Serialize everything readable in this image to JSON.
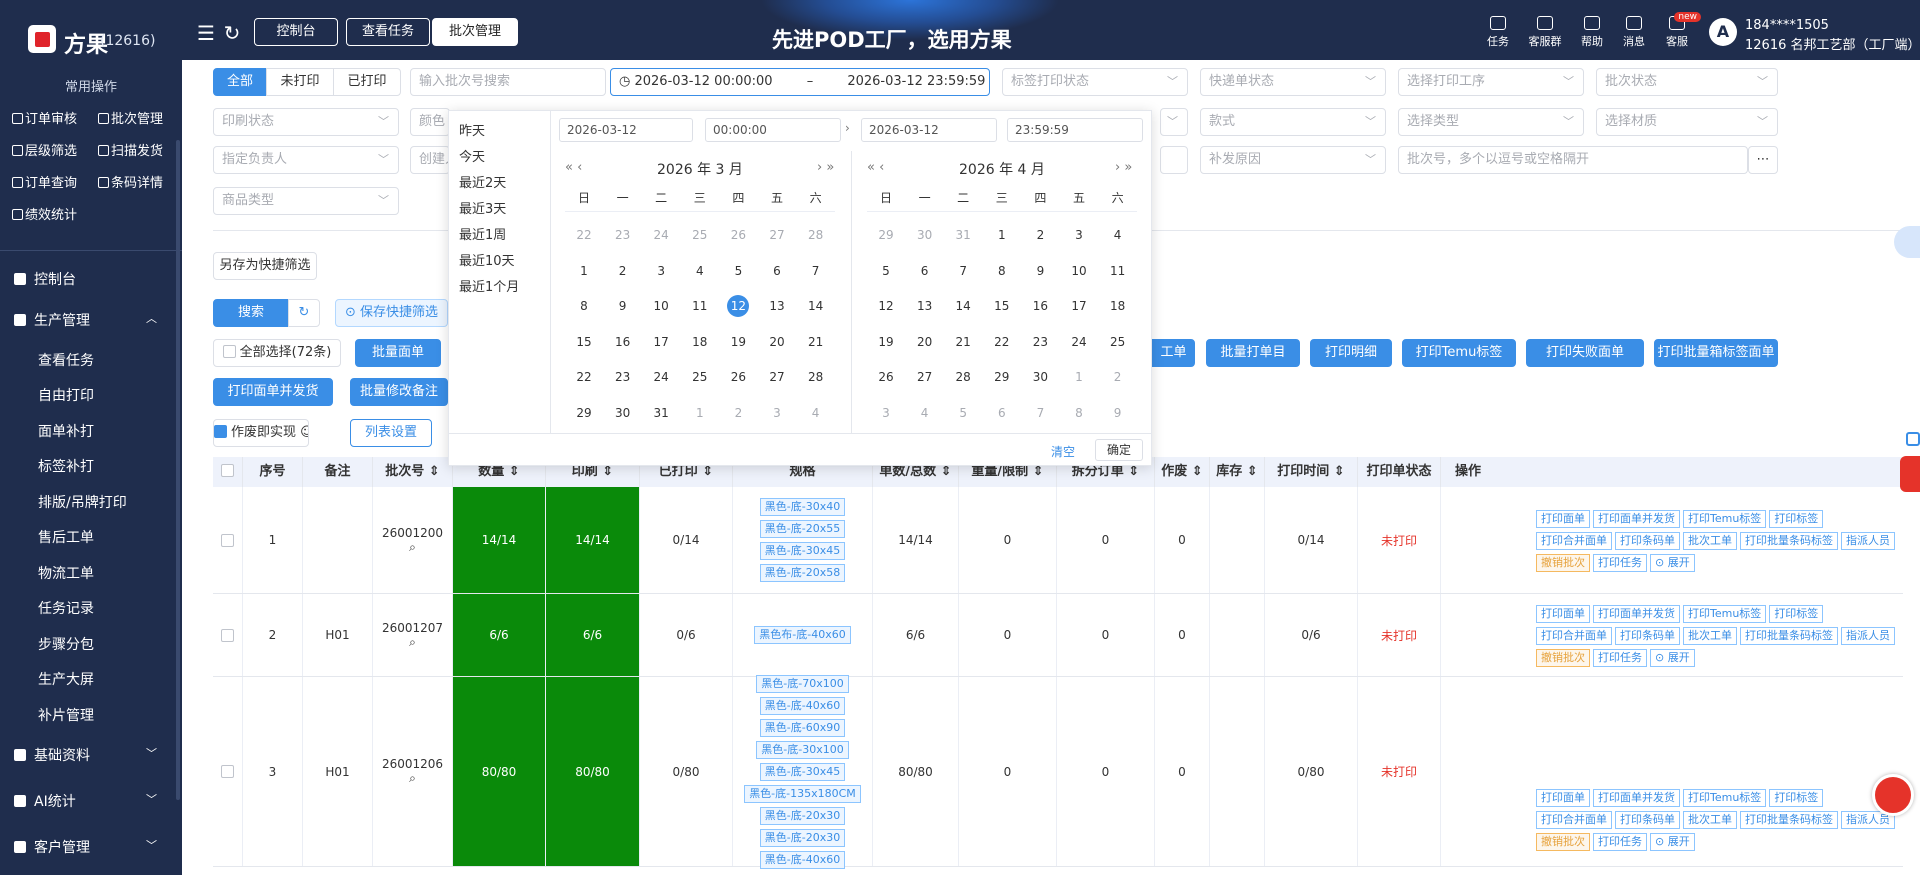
{
  "brand": {
    "name": "方果",
    "sub": "(12616)"
  },
  "nav_tabs": [
    "控制台",
    "查看任务",
    "批次管理"
  ],
  "slogan": "先进POD工厂，选用方果",
  "toolbar": [
    {
      "label": "任务"
    },
    {
      "label": "客服群"
    },
    {
      "label": "帮助"
    },
    {
      "label": "消息"
    },
    {
      "label": "客服",
      "badge": "new"
    }
  ],
  "user": {
    "avatar": "A",
    "line1": "184****1505",
    "line2": "12616 名邦工艺部（工厂端）"
  },
  "sidebar": {
    "section": "常用操作",
    "quick": [
      [
        "订单审核",
        "批次管理"
      ],
      [
        "层级筛选",
        "扫描发货"
      ],
      [
        "订单查询",
        "条码详情"
      ],
      [
        "绩效统计"
      ]
    ],
    "menus": [
      {
        "label": "控制台"
      },
      {
        "label": "生产管理",
        "expanded": true
      },
      {
        "label": "基础资料"
      },
      {
        "label": "AI统计"
      },
      {
        "label": "客户管理"
      }
    ],
    "sub_items": [
      "查看任务",
      "自由打印",
      "面单补打",
      "标签补打",
      "排版/吊牌打印",
      "售后工单",
      "物流工单",
      "任务记录",
      "步骤分包",
      "生产大屏",
      "补片管理"
    ]
  },
  "filters": {
    "status_tabs": [
      "全部",
      "未打印",
      "已打印"
    ],
    "row1": {
      "keyword_placeholder": "输入批次号搜索",
      "date_start": "2026-03-12 00:00:00",
      "date_sep": "–",
      "date_end": "2026-03-12 23:59:59",
      "print_status": "标签打印状态",
      "logistics": "快递单状态",
      "printer": "选择打印工序",
      "batch_status": "批次状态"
    },
    "row2": {
      "a": "印刷状态",
      "b": "颜色",
      "c": "款式",
      "d": "选择类型",
      "e": "选择材质"
    },
    "row3": {
      "a": "指定负责人",
      "b": "创建人",
      "c": "补发原因",
      "d": "批次号，多个以逗号或空格隔开"
    },
    "row4": {
      "a": "商品类型"
    }
  },
  "buttons": {
    "save_default": "另存为快捷筛选",
    "search": "搜索",
    "refresh": "↻",
    "quick_filter": "⊙ 保存快捷筛选",
    "select_all": "全部选择(72条)",
    "print_bill": "批量面单",
    "post_mfg": "工单",
    "batch_print_list": "批量打单目",
    "print_detail": "打印明细",
    "print_temu": "打印Temu标签",
    "print_lost": "打印失败面单",
    "print_big": "打印批量箱标签面单",
    "print_slip": "打印面单并发货",
    "batch_modify": "批量修改备注",
    "fast_print": "作废即实现 ☺",
    "column_set": "列表设置"
  },
  "table": {
    "headers": [
      "",
      "序号",
      "备注",
      "批次号 ⇕",
      "数量 ⇕",
      "印刷 ⇕",
      "已打印 ⇕",
      "规格",
      "单数/总数 ⇕",
      "重量/限制 ⇕",
      "拆分订单 ⇕",
      "作废 ⇕",
      "库存 ⇕",
      "打印时间 ⇕",
      "打印单状态",
      "操作"
    ],
    "rows": [
      {
        "seq": "1",
        "note": "",
        "batch": "26001200",
        "qty": "14/14",
        "printed": "14/14",
        "done": "0/14",
        "specs": [
          "黑色-底-30x40",
          "黑色-底-20x55",
          "黑色-底-30x45",
          "黑色-底-20x58"
        ],
        "ratio": "14/14",
        "w": "0",
        "split": "0",
        "cancel": "0",
        "stock": "",
        "ptime": "0/14",
        "pstate": "未打印"
      },
      {
        "seq": "2",
        "note": "H01",
        "batch": "26001207",
        "qty": "6/6",
        "printed": "6/6",
        "done": "0/6",
        "specs": [
          "黑色布-底-40x60"
        ],
        "ratio": "6/6",
        "w": "0",
        "split": "0",
        "cancel": "0",
        "stock": "",
        "ptime": "0/6",
        "pstate": "未打印"
      },
      {
        "seq": "3",
        "note": "H01",
        "batch": "26001206",
        "qty": "80/80",
        "printed": "80/80",
        "done": "0/80",
        "specs": [
          "黑色-底-70x100",
          "黑色-底-40x60",
          "黑色-底-60x90",
          "黑色-底-30x100",
          "黑色-底-30x45",
          "黑色-底-135x180CM",
          "黑色-底-20x30",
          "黑色-底-20x30",
          "黑色-底-40x60"
        ],
        "ratio": "80/80",
        "w": "0",
        "split": "0",
        "cancel": "0",
        "stock": "",
        "ptime": "0/80",
        "pstate": "未打印"
      }
    ],
    "ops": [
      {
        "label": "打印面单"
      },
      {
        "label": "打印面单并发货"
      },
      {
        "label": "打印Temu标签"
      },
      {
        "label": "打印标签"
      },
      {
        "label": "打印合并面单"
      },
      {
        "label": "打印条码单"
      },
      {
        "label": "批次工单"
      },
      {
        "label": "打印批量条码标签"
      },
      {
        "label": "指派人员"
      },
      {
        "label": "撤销批次",
        "warn": true
      },
      {
        "label": "打印任务"
      },
      {
        "label": "⊙ 展开"
      }
    ]
  },
  "picker": {
    "shortcuts": [
      "昨天",
      "今天",
      "最近2天",
      "最近3天",
      "最近1周",
      "最近10天",
      "最近1个月"
    ],
    "left_date": "2026-03-12",
    "left_time": "00:00:00",
    "right_date": "2026-03-12",
    "right_time": "23:59:59",
    "left_title": "2026 年 3 月",
    "right_title": "2026 年 4 月",
    "nav_left": "« ‹",
    "nav_right": "› »",
    "weekdays": [
      "日",
      "一",
      "二",
      "三",
      "四",
      "五",
      "六"
    ],
    "left_days": [
      "22",
      "23",
      "24",
      "25",
      "26",
      "27",
      "28",
      "1",
      "2",
      "3",
      "4",
      "5",
      "6",
      "7",
      "8",
      "9",
      "10",
      "11",
      "12",
      "13",
      "14",
      "15",
      "16",
      "17",
      "18",
      "19",
      "20",
      "21",
      "22",
      "23",
      "24",
      "25",
      "26",
      "27",
      "28",
      "29",
      "30",
      "31",
      "1",
      "2",
      "3",
      "4"
    ],
    "right_days": [
      "29",
      "30",
      "31",
      "1",
      "2",
      "3",
      "4",
      "5",
      "6",
      "7",
      "8",
      "9",
      "10",
      "11",
      "12",
      "13",
      "14",
      "15",
      "16",
      "17",
      "18",
      "19",
      "20",
      "21",
      "22",
      "23",
      "24",
      "25",
      "26",
      "27",
      "28",
      "29",
      "30",
      "1",
      "2",
      "3",
      "4",
      "5",
      "6",
      "7",
      "8",
      "9"
    ],
    "clear": "清空",
    "confirm": "确定"
  },
  "colors": {
    "sidebar": "#1f2d4d",
    "primary": "#3a8ee6",
    "green": "#0a8a0a",
    "danger": "#e5332a"
  }
}
